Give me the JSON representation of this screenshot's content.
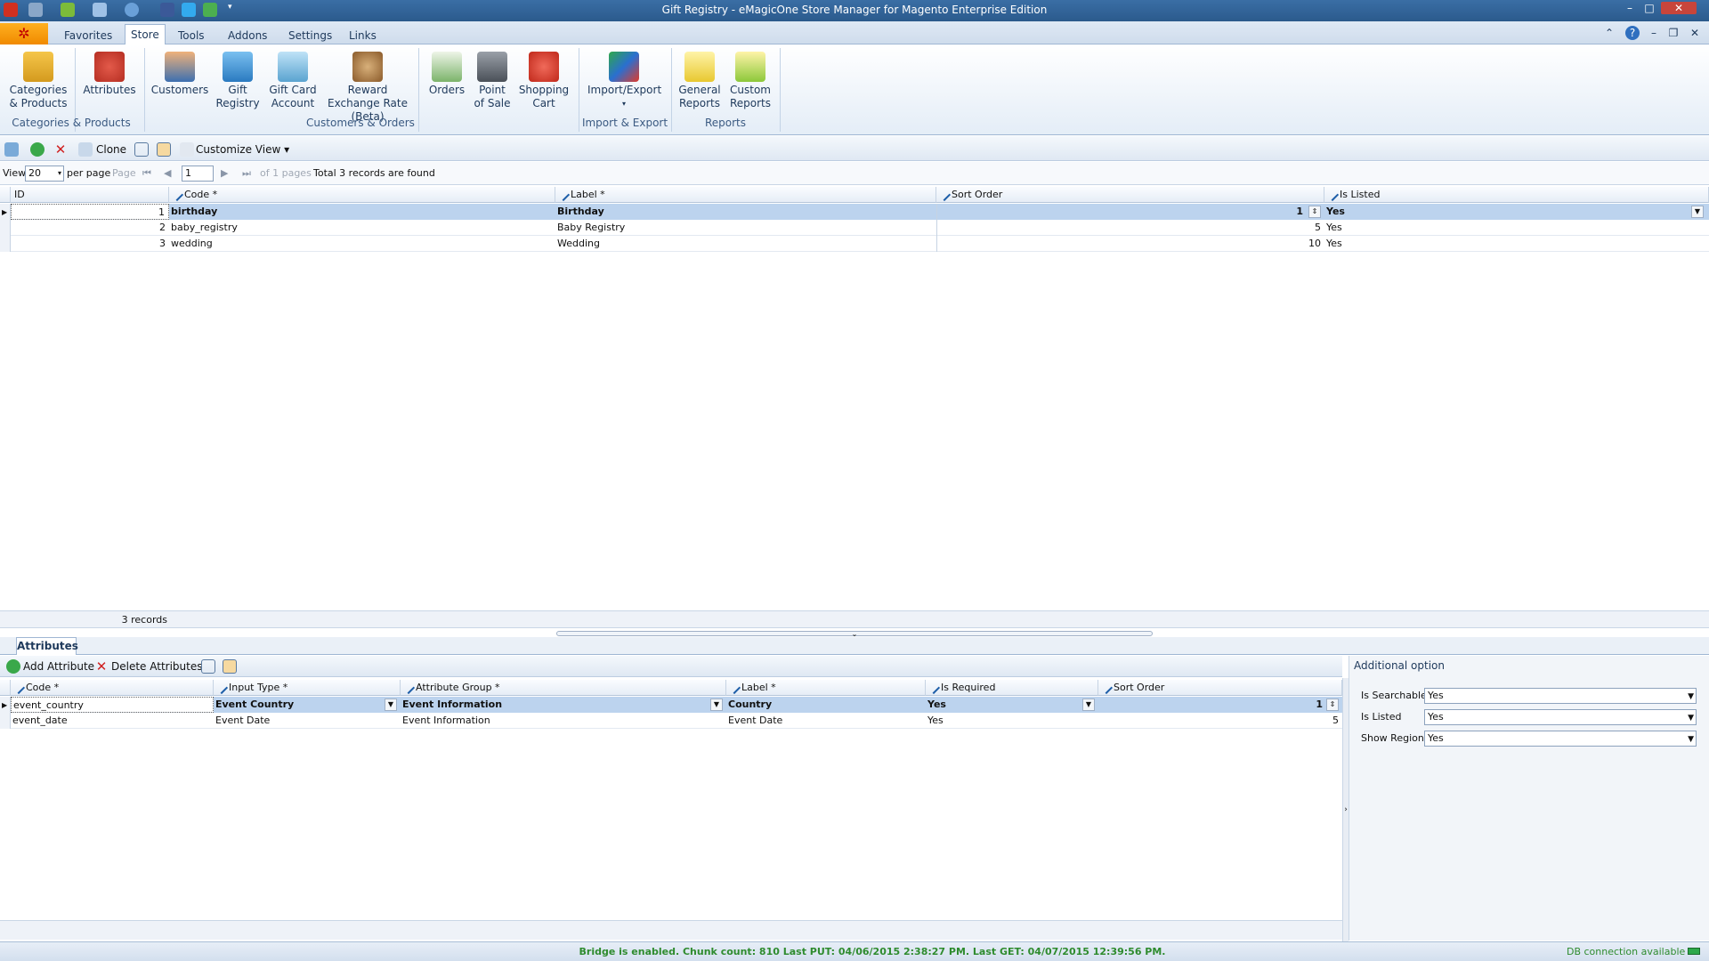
{
  "window": {
    "title": "Gift Registry - eMagicOne Store Manager for Magento Enterprise Edition"
  },
  "menu": {
    "tabs": [
      "Favorites",
      "Store",
      "Tools",
      "Addons",
      "Settings",
      "Links"
    ],
    "active": "Store"
  },
  "ribbon": {
    "buttons": {
      "categories": "Categories & Products",
      "attributes": "Attributes",
      "customers": "Customers",
      "gift_registry": "Gift Registry",
      "gift_card": "Gift Card Account",
      "reward": "Reward Exchange Rate (Beta)",
      "orders": "Orders",
      "pos": "Point of Sale",
      "cart": "Shopping Cart",
      "import_export": "Import/Export",
      "general_reports": "General Reports",
      "custom_reports": "Custom Reports"
    },
    "groups": {
      "categories": "Categories & Products",
      "customers_orders": "Customers & Orders",
      "import_export": "Import & Export",
      "reports": "Reports"
    }
  },
  "toolbar": {
    "clone": "Clone",
    "customize_view": "Customize View"
  },
  "pager": {
    "view_label": "View",
    "per_page_value": "20",
    "per_page_label": "per page",
    "page_label": "Page",
    "page_value": "1",
    "of_pages": "of 1 pages",
    "total": "Total 3 records are found"
  },
  "main_grid": {
    "columns": [
      "ID",
      "Code *",
      "Label *",
      "Sort Order",
      "Is Listed"
    ],
    "rows": [
      {
        "id": "1",
        "code": "birthday",
        "label": "Birthday",
        "sort": "1",
        "listed": "Yes"
      },
      {
        "id": "2",
        "code": "baby_registry",
        "label": "Baby Registry",
        "sort": "5",
        "listed": "Yes"
      },
      {
        "id": "3",
        "code": "wedding",
        "label": "Wedding",
        "sort": "10",
        "listed": "Yes"
      }
    ],
    "footer": "3 records"
  },
  "detail": {
    "tab": "Attributes",
    "add": "Add Attribute",
    "delete": "Delete Attributes",
    "columns": [
      "Code *",
      "Input Type *",
      "Attribute Group *",
      "Label *",
      "Is Required",
      "Sort Order"
    ],
    "rows": [
      {
        "code": "event_country",
        "input": "Event Country",
        "group": "Event Information",
        "label": "Country",
        "required": "Yes",
        "sort": "1"
      },
      {
        "code": "event_date",
        "input": "Event Date",
        "group": "Event Information",
        "label": "Event Date",
        "required": "Yes",
        "sort": "5"
      }
    ]
  },
  "additional": {
    "title": "Additional option",
    "options": [
      {
        "label": "Is Searchable",
        "value": "Yes"
      },
      {
        "label": "Is Listed",
        "value": "Yes"
      },
      {
        "label": "Show Region",
        "value": "Yes"
      }
    ]
  },
  "status": {
    "bridge": "Bridge is enabled. Chunk count: 810 Last PUT: 04/06/2015 2:38:27 PM. Last GET: 04/07/2015 12:39:56 PM.",
    "db": "DB connection available"
  },
  "colors": {
    "titlebar": "#2b5a8c",
    "selection": "#bcd3ee",
    "status_text": "#2e8b2e"
  }
}
